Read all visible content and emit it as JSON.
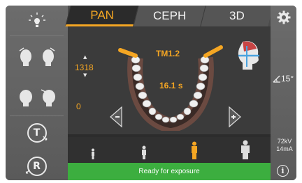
{
  "tabs": [
    {
      "label": "PAN",
      "active": true
    },
    {
      "label": "CEPH",
      "active": false
    },
    {
      "label": "3D",
      "active": false
    }
  ],
  "main": {
    "mm_value": "1318",
    "mm_zero": "0",
    "program": "TM1.2",
    "exposure_time": "16.1 s"
  },
  "left": {
    "light_icon": "light-bulb-icon",
    "buttons": [
      {
        "name": "head-tilt-left-right-icon"
      },
      {
        "name": "head-rotate-icon"
      },
      {
        "name": "t-button",
        "label": "T"
      },
      {
        "name": "r-button",
        "label": "R"
      }
    ]
  },
  "right": {
    "angle": "15°",
    "kv": "72kV",
    "ma": "14mA",
    "info_label": "i"
  },
  "patient_sizes": [
    "child",
    "small-adult",
    "adult",
    "large-adult"
  ],
  "selected_size": "adult",
  "status": {
    "text": "Ready for exposure",
    "color": "#3cae3f"
  },
  "accent_color": "#f5a623"
}
